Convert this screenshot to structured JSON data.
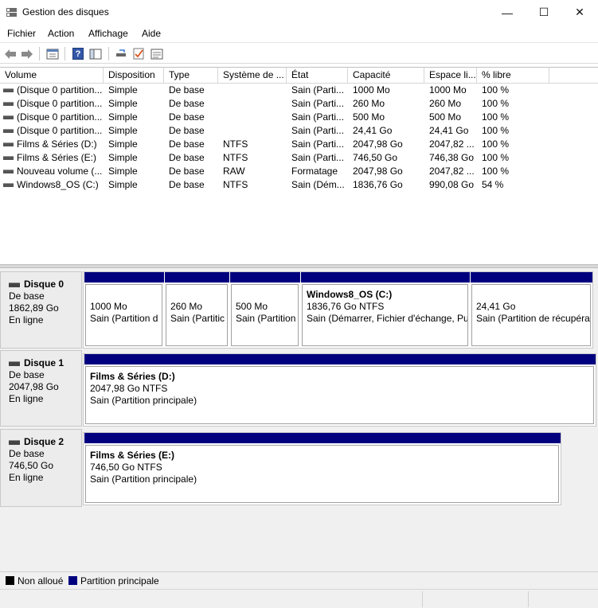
{
  "window": {
    "title": "Gestion des disques",
    "min_glyph": "—",
    "max_glyph": "☐",
    "close_glyph": "✕"
  },
  "menu": [
    "Fichier",
    "Action",
    "Affichage",
    "Aide"
  ],
  "toolbar": {
    "help_glyph": "?"
  },
  "columns": [
    "Volume",
    "Disposition",
    "Type",
    "Système de ...",
    "État",
    "Capacité",
    "Espace li...",
    "% libre"
  ],
  "volumes": [
    [
      "(Disque 0 partition...",
      "Simple",
      "De base",
      "",
      "Sain (Parti...",
      "1000 Mo",
      "1000 Mo",
      "100 %"
    ],
    [
      "(Disque 0 partition...",
      "Simple",
      "De base",
      "",
      "Sain (Parti...",
      "260 Mo",
      "260 Mo",
      "100 %"
    ],
    [
      "(Disque 0 partition...",
      "Simple",
      "De base",
      "",
      "Sain (Parti...",
      "500 Mo",
      "500 Mo",
      "100 %"
    ],
    [
      "(Disque 0 partition...",
      "Simple",
      "De base",
      "",
      "Sain (Parti...",
      "24,41 Go",
      "24,41 Go",
      "100 %"
    ],
    [
      "Films & Séries (D:)",
      "Simple",
      "De base",
      "NTFS",
      "Sain (Parti...",
      "2047,98 Go",
      "2047,82 ...",
      "100 %"
    ],
    [
      "Films & Séries (E:)",
      "Simple",
      "De base",
      "NTFS",
      "Sain (Parti...",
      "746,50 Go",
      "746,38 Go",
      "100 %"
    ],
    [
      "Nouveau volume (...",
      "Simple",
      "De base",
      "RAW",
      "Formatage",
      "2047,98 Go",
      "2047,82 ...",
      "100 %"
    ],
    [
      "Windows8_OS (C:)",
      "Simple",
      "De base",
      "NTFS",
      "Sain (Dém...",
      "1836,76 Go",
      "990,08 Go",
      "54 %"
    ]
  ],
  "disks": [
    {
      "name": "Disque 0",
      "type": "De base",
      "size": "1862,89 Go",
      "status": "En ligne",
      "partitions": [
        {
          "name": "",
          "line1": "1000 Mo",
          "line2": "Sain (Partition d"
        },
        {
          "name": "",
          "line1": "260 Mo",
          "line2": "Sain (Partitic"
        },
        {
          "name": "",
          "line1": "500 Mo",
          "line2": "Sain (Partition"
        },
        {
          "name": "Windows8_OS  (C:)",
          "line1": "1836,76 Go NTFS",
          "line2": "Sain (Démarrer, Fichier d'échange, Pu"
        },
        {
          "name": "",
          "line1": "24,41 Go",
          "line2": "Sain (Partition de récupéra"
        }
      ]
    },
    {
      "name": "Disque 1",
      "type": "De base",
      "size": "2047,98 Go",
      "status": "En ligne",
      "partitions": [
        {
          "name": "Films & Séries  (D:)",
          "line1": "2047,98 Go NTFS",
          "line2": "Sain (Partition principale)"
        }
      ]
    },
    {
      "name": "Disque 2",
      "type": "De base",
      "size": "746,50 Go",
      "status": "En ligne",
      "partitions": [
        {
          "name": "Films & Séries  (E:)",
          "line1": "746,50 Go NTFS",
          "line2": "Sain (Partition principale)"
        }
      ]
    }
  ],
  "legend": [
    {
      "label": "Non alloué",
      "color": "#000000"
    },
    {
      "label": "Partition principale",
      "color": "#00007f"
    }
  ]
}
